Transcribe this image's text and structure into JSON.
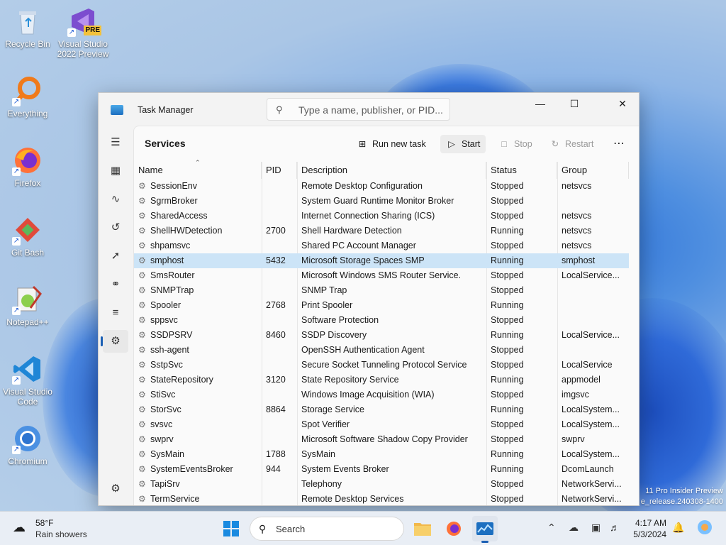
{
  "desktop": {
    "icons": [
      {
        "label": "Recycle Bin",
        "icon": "recycle-bin-icon"
      },
      {
        "label": "Visual Studio 2022 Preview",
        "icon": "visual-studio-preview-icon",
        "badge": "PRE"
      },
      {
        "label": "Everything",
        "icon": "everything-search-icon"
      },
      {
        "label": "Firefox",
        "icon": "firefox-icon"
      },
      {
        "label": "Git Bash",
        "icon": "git-bash-icon"
      },
      {
        "label": "Notepad++",
        "icon": "notepad-plus-plus-icon"
      },
      {
        "label": "Visual Studio Code",
        "icon": "vscode-icon"
      },
      {
        "label": "Chromium",
        "icon": "chromium-icon"
      }
    ],
    "watermark_line1": "11 Pro Insider Preview",
    "watermark_line2": "e_release.240308-1400"
  },
  "window": {
    "title": "Task Manager",
    "search_placeholder": "Type a name, publisher, or PID...",
    "page_title": "Services",
    "commands": {
      "run_new_task": "Run new task",
      "start": "Start",
      "stop": "Stop",
      "restart": "Restart"
    },
    "columns": [
      "Name",
      "PID",
      "Description",
      "Status",
      "Group"
    ],
    "rows": [
      {
        "name": "SessionEnv",
        "pid": "",
        "description": "Remote Desktop Configuration",
        "status": "Stopped",
        "group": "netsvcs"
      },
      {
        "name": "SgrmBroker",
        "pid": "",
        "description": "System Guard Runtime Monitor Broker",
        "status": "Stopped",
        "group": ""
      },
      {
        "name": "SharedAccess",
        "pid": "",
        "description": "Internet Connection Sharing (ICS)",
        "status": "Stopped",
        "group": "netsvcs"
      },
      {
        "name": "ShellHWDetection",
        "pid": "2700",
        "description": "Shell Hardware Detection",
        "status": "Running",
        "group": "netsvcs"
      },
      {
        "name": "shpamsvc",
        "pid": "",
        "description": "Shared PC Account Manager",
        "status": "Stopped",
        "group": "netsvcs"
      },
      {
        "name": "smphost",
        "pid": "5432",
        "description": "Microsoft Storage Spaces SMP",
        "status": "Running",
        "group": "smphost"
      },
      {
        "name": "SmsRouter",
        "pid": "",
        "description": "Microsoft Windows SMS Router Service.",
        "status": "Stopped",
        "group": "LocalService..."
      },
      {
        "name": "SNMPTrap",
        "pid": "",
        "description": "SNMP Trap",
        "status": "Stopped",
        "group": ""
      },
      {
        "name": "Spooler",
        "pid": "2768",
        "description": "Print Spooler",
        "status": "Running",
        "group": ""
      },
      {
        "name": "sppsvc",
        "pid": "",
        "description": "Software Protection",
        "status": "Stopped",
        "group": ""
      },
      {
        "name": "SSDPSRV",
        "pid": "8460",
        "description": "SSDP Discovery",
        "status": "Running",
        "group": "LocalService..."
      },
      {
        "name": "ssh-agent",
        "pid": "",
        "description": "OpenSSH Authentication Agent",
        "status": "Stopped",
        "group": ""
      },
      {
        "name": "SstpSvc",
        "pid": "",
        "description": "Secure Socket Tunneling Protocol Service",
        "status": "Stopped",
        "group": "LocalService"
      },
      {
        "name": "StateRepository",
        "pid": "3120",
        "description": "State Repository Service",
        "status": "Running",
        "group": "appmodel"
      },
      {
        "name": "StiSvc",
        "pid": "",
        "description": "Windows Image Acquisition (WIA)",
        "status": "Stopped",
        "group": "imgsvc"
      },
      {
        "name": "StorSvc",
        "pid": "8864",
        "description": "Storage Service",
        "status": "Running",
        "group": "LocalSystem..."
      },
      {
        "name": "svsvc",
        "pid": "",
        "description": "Spot Verifier",
        "status": "Stopped",
        "group": "LocalSystem..."
      },
      {
        "name": "swprv",
        "pid": "",
        "description": "Microsoft Software Shadow Copy Provider",
        "status": "Stopped",
        "group": "swprv"
      },
      {
        "name": "SysMain",
        "pid": "1788",
        "description": "SysMain",
        "status": "Running",
        "group": "LocalSystem..."
      },
      {
        "name": "SystemEventsBroker",
        "pid": "944",
        "description": "System Events Broker",
        "status": "Running",
        "group": "DcomLaunch"
      },
      {
        "name": "TapiSrv",
        "pid": "",
        "description": "Telephony",
        "status": "Stopped",
        "group": "NetworkServi..."
      },
      {
        "name": "TermService",
        "pid": "",
        "description": "Remote Desktop Services",
        "status": "Stopped",
        "group": "NetworkServi..."
      }
    ],
    "selected_row": "smphost"
  },
  "taskbar": {
    "weather_temp": "58°F",
    "weather_condition": "Rain showers",
    "search_label": "Search",
    "time": "4:17 AM",
    "date": "5/3/2024"
  },
  "colors": {
    "accent": "#1a5fb4",
    "selection": "#cce4f7"
  }
}
